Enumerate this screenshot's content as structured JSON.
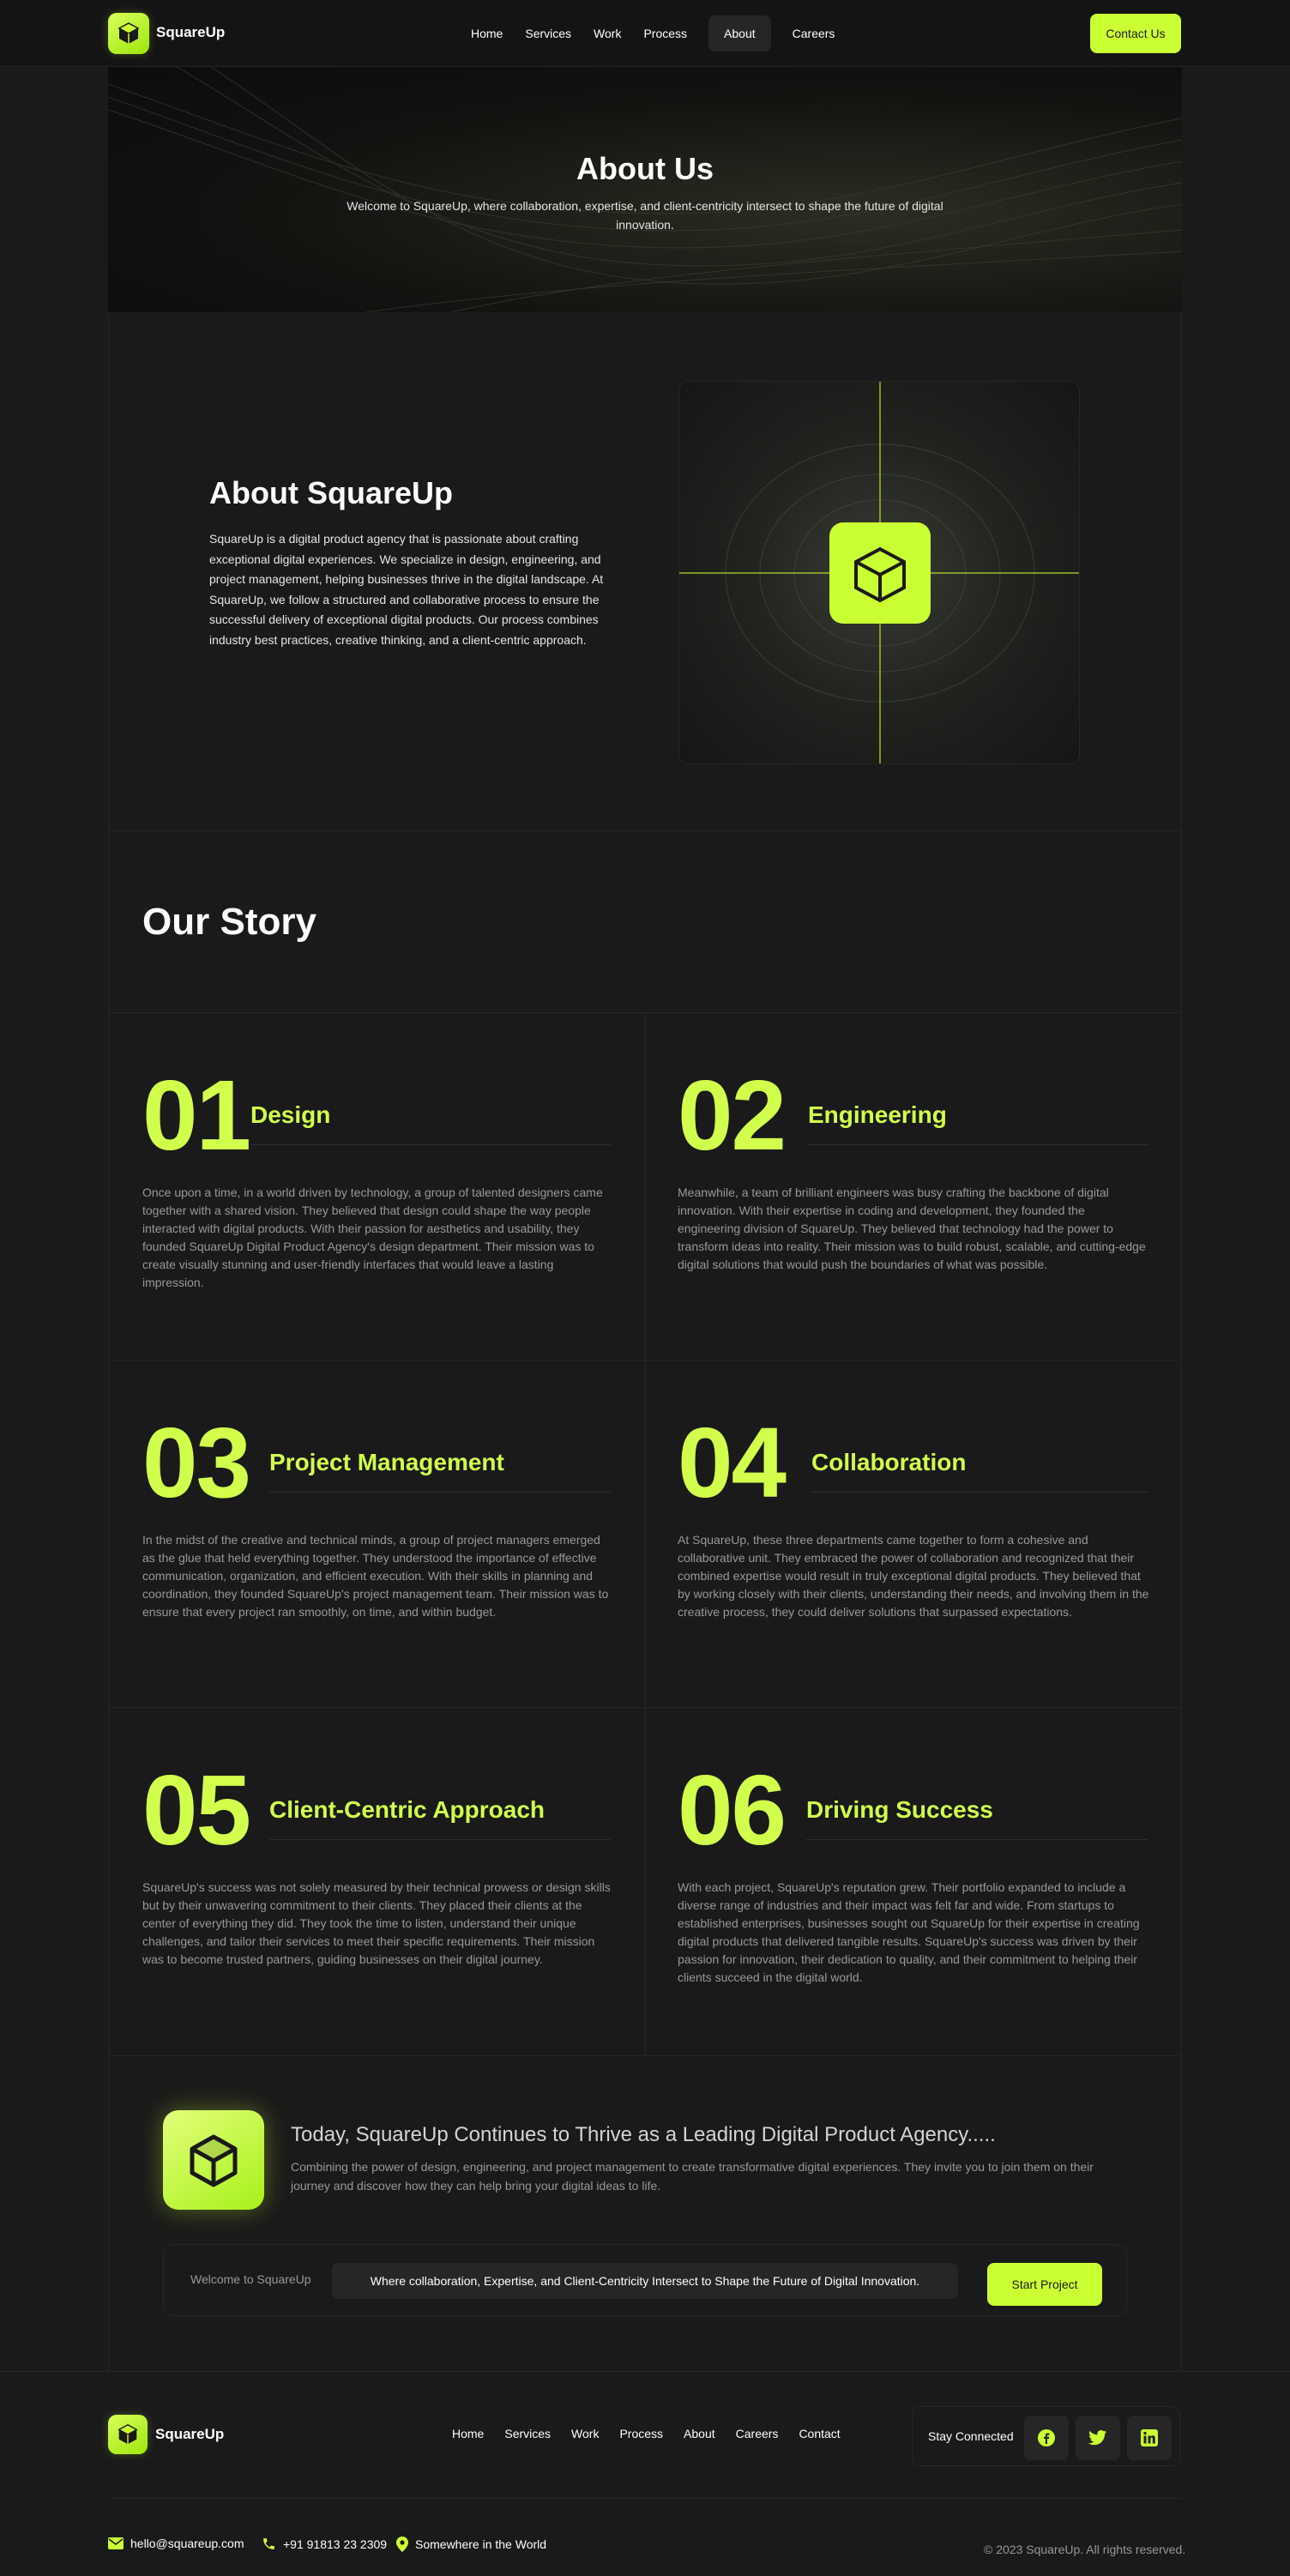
{
  "brand": {
    "name": "SquareUp",
    "accent": "#caff33"
  },
  "nav": {
    "items": [
      "Home",
      "Services",
      "Work",
      "Process",
      "About",
      "Careers"
    ],
    "active": "About",
    "contact_label": "Contact Us"
  },
  "hero": {
    "title": "About Us",
    "subtitle": "Welcome to SquareUp, where collaboration, expertise, and client-centricity intersect to shape the future of digital innovation."
  },
  "about": {
    "title": "About SquareUp",
    "text": "SquareUp is a digital product agency that is passionate about crafting exceptional digital experiences. We specialize in design, engineering, and project management, helping businesses thrive in the digital landscape. At SquareUp, we follow a structured and collaborative process to ensure the successful delivery of exceptional digital products. Our process combines industry best practices, creative thinking, and a client-centric approach."
  },
  "story": {
    "title": "Our Story",
    "steps": [
      {
        "num": "01",
        "title": "Design",
        "text": "Once upon a time, in a world driven by technology, a group of talented designers came together with a shared vision. They believed that design could shape the way people interacted with digital products. With their passion for aesthetics and usability, they founded SquareUp Digital Product Agency's design department. Their mission was to create visually stunning and user-friendly interfaces that would leave a lasting impression."
      },
      {
        "num": "02",
        "title": "Engineering",
        "text": "Meanwhile, a team of brilliant engineers was busy crafting the backbone of digital innovation. With their expertise in coding and development, they founded the engineering division of SquareUp. They believed that technology had the power to transform ideas into reality. Their mission was to build robust, scalable, and cutting-edge digital solutions that would push the boundaries of what was possible."
      },
      {
        "num": "03",
        "title": "Project Management",
        "text": "In the midst of the creative and technical minds, a group of project managers emerged as the glue that held everything together. They understood the importance of effective communication, organization, and efficient execution. With their skills in planning and coordination, they founded SquareUp's project management team. Their mission was to ensure that every project ran smoothly, on time, and within budget."
      },
      {
        "num": "04",
        "title": "Collaboration",
        "text": "At SquareUp, these three departments came together to form a cohesive and collaborative unit. They embraced the power of collaboration and recognized that their combined expertise would result in truly exceptional digital products. They believed that by working closely with their clients, understanding their needs, and involving them in the creative process, they could deliver solutions that surpassed expectations."
      },
      {
        "num": "05",
        "title": "Client-Centric Approach",
        "text": "SquareUp's success was not solely measured by their technical prowess or design skills but by their unwavering commitment to their clients. They placed their clients at the center of everything they did. They took the time to listen, understand their unique challenges, and tailor their services to meet their specific requirements. Their mission was to become trusted partners, guiding businesses on their digital journey."
      },
      {
        "num": "06",
        "title": "Driving Success",
        "text": "With each project, SquareUp's reputation grew. Their portfolio expanded to include a diverse range of industries and their impact was felt far and wide. From startups to established enterprises, businesses sought out SquareUp for their expertise in creating digital products that delivered tangible results. SquareUp's success was driven by their passion for innovation, their dedication to quality, and their commitment to helping their clients succeed in the digital world."
      }
    ]
  },
  "cta": {
    "title": "Today, SquareUp Continues to Thrive as a Leading Digital Product Agency.....",
    "text": "Combining the power of design, engineering, and project management to create transformative digital experiences. They invite you to join them on their journey and discover how they can help bring your digital ideas to life.",
    "welcome": "Welcome to SquareUp",
    "tagline": "Where collaboration, Expertise, and Client-Centricity Intersect to Shape the Future of Digital Innovation.",
    "button": "Start Project"
  },
  "footer": {
    "nav": [
      "Home",
      "Services",
      "Work",
      "Process",
      "About",
      "Careers",
      "Contact"
    ],
    "stay_connected": "Stay Connected",
    "social": [
      "facebook-icon",
      "twitter-icon",
      "linkedin-icon"
    ],
    "email": "hello@squareup.com",
    "phone": "+91 91813 23 2309",
    "location": "Somewhere in the World",
    "copyright": "© 2023 SquareUp. All rights reserved."
  }
}
